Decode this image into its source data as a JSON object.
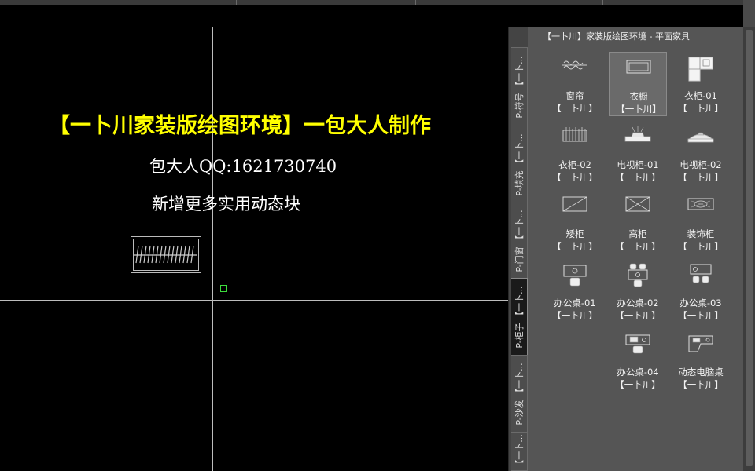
{
  "palette": {
    "title": "【一卜川】家装版绘图环境 - 平面家具",
    "tabs": [
      "P-符号 【一卜...",
      "P-填充 【一卜...",
      "P-门窗 【一卜...",
      "P-柜子 【一卜...",
      "P-沙发 【一卜...",
      "【一卜..."
    ],
    "active_tab": "P-柜子 【一卜...",
    "items": [
      {
        "name": "窗帘",
        "tag": "【一卜川】",
        "icon": "curtain-icon"
      },
      {
        "name": "衣橱",
        "tag": "【一卜川】",
        "icon": "wardrobe-icon"
      },
      {
        "name": "衣柜-01",
        "tag": "【一卜川】",
        "icon": "wardrobe-01-icon"
      },
      {
        "name": "衣柜-02",
        "tag": "【一卜川】",
        "icon": "wardrobe-02-icon"
      },
      {
        "name": "电视柜-01",
        "tag": "【一卜川】",
        "icon": "tv-cabinet-01-icon"
      },
      {
        "name": "电视柜-02",
        "tag": "【一卜川】",
        "icon": "tv-cabinet-02-icon"
      },
      {
        "name": "矮柜",
        "tag": "【一卜川】",
        "icon": "low-cabinet-icon"
      },
      {
        "name": "高柜",
        "tag": "【一卜川】",
        "icon": "tall-cabinet-icon"
      },
      {
        "name": "装饰柜",
        "tag": "【一卜川】",
        "icon": "decor-cabinet-icon"
      },
      {
        "name": "办公桌-01",
        "tag": "【一卜川】",
        "icon": "office-desk-01-icon"
      },
      {
        "name": "办公桌-02",
        "tag": "【一卜川】",
        "icon": "office-desk-02-icon"
      },
      {
        "name": "办公桌-03",
        "tag": "【一卜川】",
        "icon": "office-desk-03-icon"
      },
      {
        "name": "办公桌-04",
        "tag": "【一卜川】",
        "icon": "office-desk-04-icon"
      },
      {
        "name": "动态电脑桌",
        "tag": "【一卜川】",
        "icon": "computer-desk-icon"
      }
    ],
    "selected_item": "衣橱"
  },
  "canvas": {
    "title": "【一卜川家装版绘图环境】一包大人制作",
    "qq": "包大人QQ:1621730740",
    "note": "新增更多实用动态块"
  },
  "colors": {
    "canvas_bg": "#000000",
    "title_text": "#ffff00",
    "body_text": "#ffffff",
    "crosshair": "#bdbdbd",
    "pickbox": "#3cdc3c",
    "palette_bg": "#555555"
  }
}
